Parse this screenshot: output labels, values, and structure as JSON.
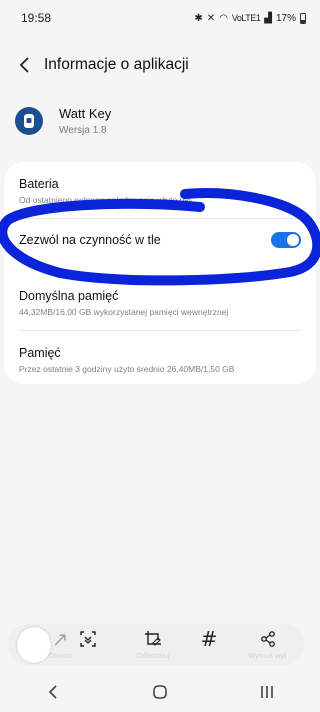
{
  "status_bar": {
    "time": "19:58",
    "network_label": "VoLTE1",
    "battery": "17%"
  },
  "header": {
    "title": "Informacje o aplikacji"
  },
  "app": {
    "name": "Watt Key",
    "version": "Wersja 1.8"
  },
  "settings": {
    "battery": {
      "title": "Bateria",
      "subtitle": "Od ostatniego pełnego naładowania użyto 0%"
    },
    "background": {
      "title": "Zezwól na czynność w tle",
      "enabled": true
    },
    "storage": {
      "title": "Domyślna pamięć",
      "subtitle": "44,32MB/16,00 GB wykorzystanej pamięci wewnętrznej"
    },
    "memory": {
      "title": "Pamięć",
      "subtitle": "Przez ostatnie 3 godziny użyto średnio 26,40MB/1,50 GB"
    }
  },
  "toolbar": {
    "open_label": "Otwórz",
    "edit_label": "Odinstaluj",
    "hash_symbol": "#",
    "share_label": "Wymuś wył."
  },
  "colors": {
    "accent": "#1a73e8",
    "annotation": "#0b24d9",
    "app_icon": "#1b4f8f"
  }
}
